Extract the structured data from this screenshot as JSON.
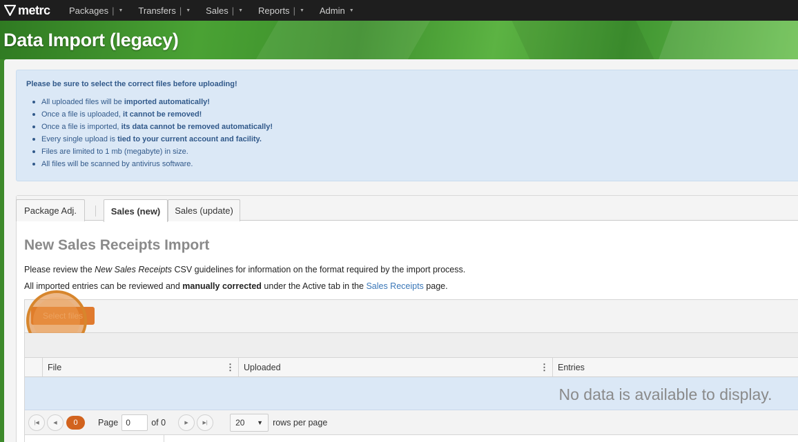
{
  "nav": {
    "logo_text": "metrc",
    "items": [
      {
        "label": "Packages"
      },
      {
        "label": "Transfers"
      },
      {
        "label": "Sales"
      },
      {
        "label": "Reports"
      },
      {
        "label": "Admin"
      }
    ]
  },
  "header": {
    "title": "Data Import (legacy)"
  },
  "alert": {
    "title": "Please be sure to select the correct files before uploading!",
    "items": [
      {
        "pre": "All uploaded files will be ",
        "bold": "imported automatically!",
        "post": ""
      },
      {
        "pre": "Once a file is uploaded, ",
        "bold": "it cannot be removed!",
        "post": ""
      },
      {
        "pre": "Once a file is imported, ",
        "bold": "its data cannot be removed automatically!",
        "post": ""
      },
      {
        "pre": "Every single upload is ",
        "bold": "tied to your current account and facility.",
        "post": ""
      },
      {
        "pre": "Files are limited to 1 mb (megabyte) in size.",
        "bold": "",
        "post": ""
      },
      {
        "pre": "All files will be scanned by antivirus software.",
        "bold": "",
        "post": ""
      }
    ]
  },
  "tabs": [
    {
      "label": "Package Adj."
    },
    {
      "label": "Sales (new)"
    },
    {
      "label": "Sales (update)"
    }
  ],
  "content": {
    "title": "New Sales Receipts Import",
    "para1_pre": "Please review the ",
    "para1_em": "New Sales Receipts",
    "para1_post": " CSV guidelines for information on the format required by the import process.",
    "para2_pre": "All imported entries can be reviewed and ",
    "para2_bold": "manually corrected",
    "para2_mid": " under the Active tab in the ",
    "para2_link": "Sales Receipts",
    "para2_post": " page."
  },
  "grid": {
    "select_button": "Select files",
    "columns": [
      {
        "label": "File"
      },
      {
        "label": "Uploaded"
      },
      {
        "label": "Entries"
      }
    ],
    "empty_message": "No data is available to display.",
    "pager": {
      "current": "0",
      "page_label": "Page",
      "page_value": "0",
      "of_label": "of 0",
      "page_size": "20",
      "rows_label": "rows per page"
    }
  },
  "colors": {
    "brand_green": "#3d8a2b",
    "accent_orange": "#e07a2e",
    "info_blue_bg": "#dbe8f6",
    "link_blue": "#3a77b8"
  },
  "icons": {
    "logo": "metrc-shield-icon",
    "column_menu": "vertical-ellipsis-icon",
    "first": "first-page-icon",
    "prev": "prev-page-icon",
    "next": "next-page-icon",
    "last": "last-page-icon",
    "dropdown": "caret-down-icon"
  }
}
